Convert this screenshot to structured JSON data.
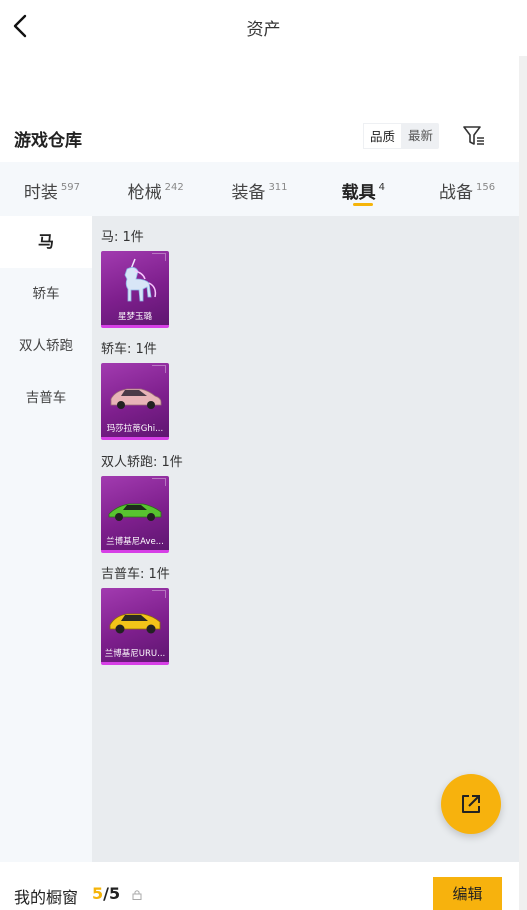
{
  "header": {
    "title": "资产"
  },
  "warehouse": {
    "title": "游戏仓库",
    "sort_options": [
      "品质",
      "最新"
    ],
    "filter_icon": "filter-icon"
  },
  "tabs": [
    {
      "label": "时装",
      "count": "597"
    },
    {
      "label": "枪械",
      "count": "242"
    },
    {
      "label": "装备",
      "count": "311"
    },
    {
      "label": "载具",
      "count": "4"
    },
    {
      "label": "战备",
      "count": "156"
    }
  ],
  "active_tab": "载具",
  "side_nav": [
    "马",
    "轿车",
    "双人轿跑",
    "吉普车"
  ],
  "active_side": "马",
  "groups": [
    {
      "label": "马: 1件",
      "item_name": "星梦玉璐",
      "art": "unicorn"
    },
    {
      "label": "轿车: 1件",
      "item_name": "玛莎拉蒂Ghi...",
      "art": "pink-sedan"
    },
    {
      "label": "双人轿跑: 1件",
      "item_name": "兰博基尼Ave...",
      "art": "green-coupe"
    },
    {
      "label": "吉普车: 1件",
      "item_name": "兰博基尼URU...",
      "art": "yellow-suv"
    }
  ],
  "bottom": {
    "showcase_label": "我的橱窗",
    "showcase_current": "5",
    "showcase_sep_total": "/5",
    "edit_label": "编辑"
  },
  "colors": {
    "accent": "#f7b20d",
    "item_purple": "#7e1f8d",
    "item_border": "#d63fe6"
  }
}
